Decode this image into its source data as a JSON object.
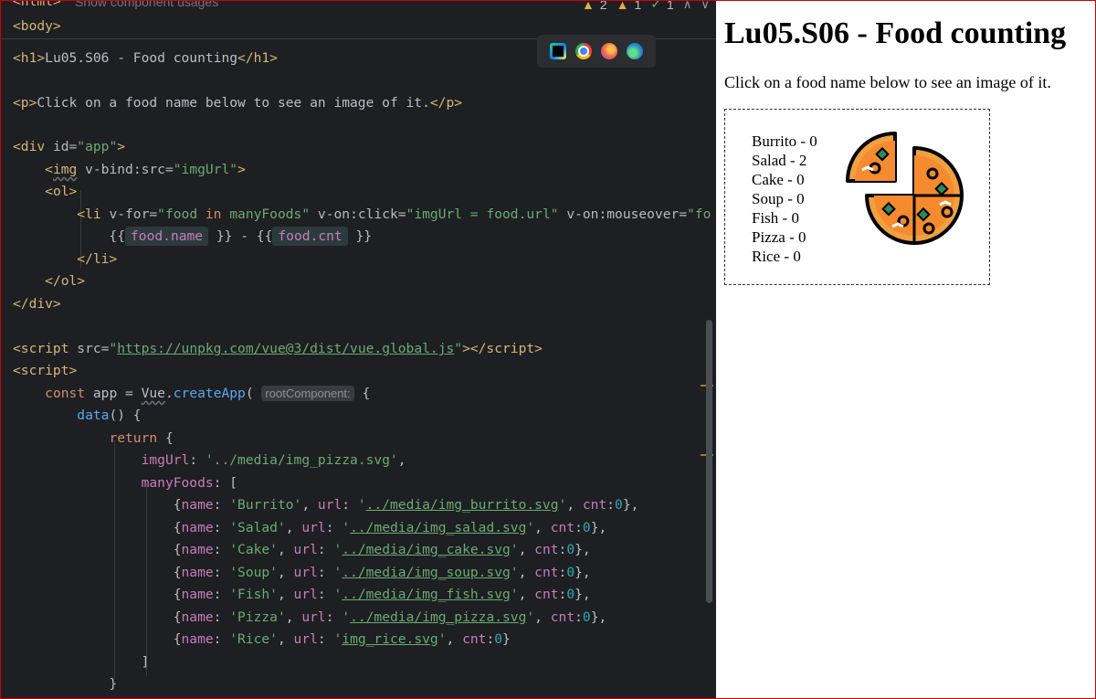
{
  "editor": {
    "breadcrumb": {
      "html_tag": "<html>",
      "hint": "Show component usages",
      "body_tag": "<body>"
    },
    "inspections": {
      "warnings": "2",
      "weak_warnings": "1",
      "ok": "1"
    }
  },
  "preview": {
    "title": "Lu05.S06 - Food counting",
    "intro": "Click on a food name below to see an image of it.",
    "foods": [
      "Burrito - 0",
      "Salad - 2",
      "Cake - 0",
      "Soup - 0",
      "Fish - 0",
      "Pizza - 0",
      "Rice - 0"
    ],
    "image_icon": "pizza-icon"
  }
}
